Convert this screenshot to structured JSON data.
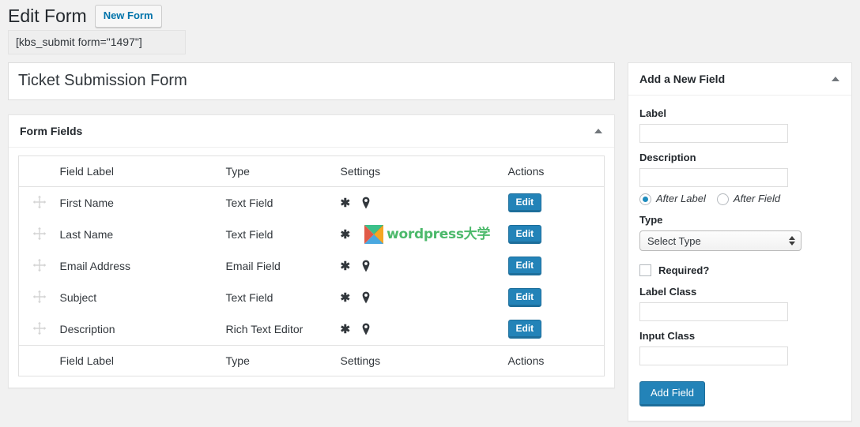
{
  "header": {
    "page_title": "Edit Form",
    "new_form_label": "New Form",
    "shortcode": "[kbs_submit form=\"1497\"]"
  },
  "form": {
    "title_value": "Ticket Submission Form",
    "title_placeholder": "Enter form name here"
  },
  "form_fields_panel": {
    "title": "Form Fields",
    "toggle_icon": "triangle-up-icon",
    "columns": [
      "Field Label",
      "Type",
      "Settings",
      "Actions"
    ],
    "rows": [
      {
        "handle_icon": "move-handle-icon",
        "label": "First Name",
        "type": "Text Field",
        "settings": [
          "asterisk-icon",
          "map-pin-icon"
        ],
        "watermark": false,
        "action_label": "Edit"
      },
      {
        "handle_icon": "move-handle-icon",
        "label": "Last Name",
        "type": "Text Field",
        "settings": [
          "asterisk-icon"
        ],
        "watermark": true,
        "action_label": "Edit"
      },
      {
        "handle_icon": "move-handle-icon",
        "label": "Email Address",
        "type": "Email Field",
        "settings": [
          "asterisk-icon",
          "map-pin-icon"
        ],
        "watermark": false,
        "action_label": "Edit"
      },
      {
        "handle_icon": "move-handle-icon",
        "label": "Subject",
        "type": "Text Field",
        "settings": [
          "asterisk-icon",
          "map-pin-icon"
        ],
        "watermark": false,
        "action_label": "Edit"
      },
      {
        "handle_icon": "move-handle-icon",
        "label": "Description",
        "type": "Rich Text Editor",
        "settings": [
          "asterisk-icon",
          "map-pin-icon"
        ],
        "watermark": false,
        "action_label": "Edit"
      }
    ]
  },
  "watermark": {
    "text_latin": "wordpress",
    "text_cjk": "大学",
    "color": "#4cb96b"
  },
  "sidebar": {
    "title": "Add a New Field",
    "toggle_icon": "triangle-up-icon",
    "label_field": {
      "label": "Label",
      "value": "",
      "placeholder": ""
    },
    "description_field": {
      "label": "Description",
      "value": "",
      "placeholder": ""
    },
    "description_position": {
      "options": [
        "After Label",
        "After Field"
      ],
      "selected": "After Label"
    },
    "type_field": {
      "label": "Type",
      "selected": "Select Type"
    },
    "required_checkbox": {
      "label": "Required?",
      "checked": false
    },
    "label_class_field": {
      "label": "Label Class",
      "value": "",
      "placeholder": ""
    },
    "input_class_field": {
      "label": "Input Class",
      "value": "",
      "placeholder": ""
    },
    "add_field_button": "Add Field"
  },
  "colors": {
    "accent_blue": "#2383b8",
    "link_blue": "#0073aa",
    "page_bg": "#f1f1f1"
  }
}
